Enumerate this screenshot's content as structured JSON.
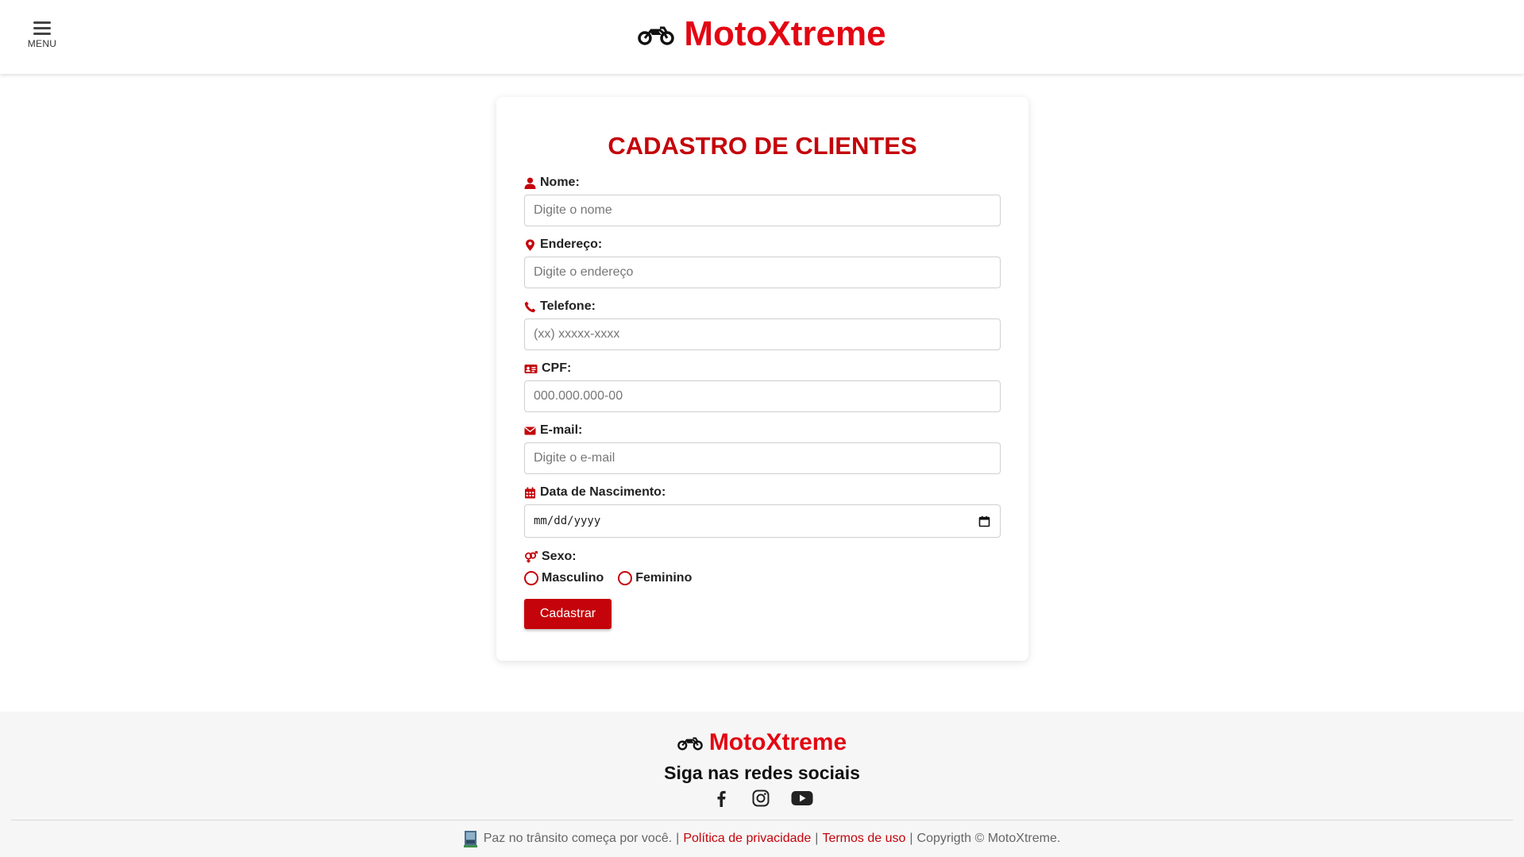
{
  "header": {
    "menu_label": "MENU",
    "brand_name": "MotoXtreme"
  },
  "form": {
    "title": "CADASTRO DE CLIENTES",
    "fields": {
      "nome": {
        "label": "Nome:",
        "placeholder": "Digite o nome",
        "icon": "user-icon"
      },
      "endereco": {
        "label": "Endereço:",
        "placeholder": "Digite o endereço",
        "icon": "map-marker-icon"
      },
      "telefone": {
        "label": "Telefone:",
        "placeholder": "(xx) xxxxx-xxxx",
        "icon": "phone-icon"
      },
      "cpf": {
        "label": "CPF:",
        "placeholder": "000.000.000-00",
        "icon": "id-card-icon"
      },
      "email": {
        "label": "E-mail:",
        "placeholder": "Digite o e-mail",
        "icon": "envelope-icon"
      },
      "nascimento": {
        "label": "Data de Nascimento:",
        "value": "mm/dd/yyyy",
        "icon": "calendar-icon"
      },
      "sexo": {
        "label": "Sexo:",
        "icon": "venus-mars-icon",
        "options": [
          "Masculino",
          "Feminino"
        ]
      }
    },
    "submit_label": "Cadastrar"
  },
  "footer": {
    "brand_name": "MotoXtreme",
    "social_title": "Siga nas redes sociais",
    "social_icons": [
      "facebook-icon",
      "instagram-icon",
      "youtube-icon"
    ],
    "tagline": "Paz no trânsito começa por você.",
    "privacy_link": "Política de privacidade",
    "terms_link": "Termos de uso",
    "separator": "|",
    "copyright": "Copyrigth © MotoXtreme."
  },
  "colors": {
    "brand_red": "#e30613",
    "accent_red": "#c4040a",
    "footer_bg": "#f6f6f6"
  }
}
